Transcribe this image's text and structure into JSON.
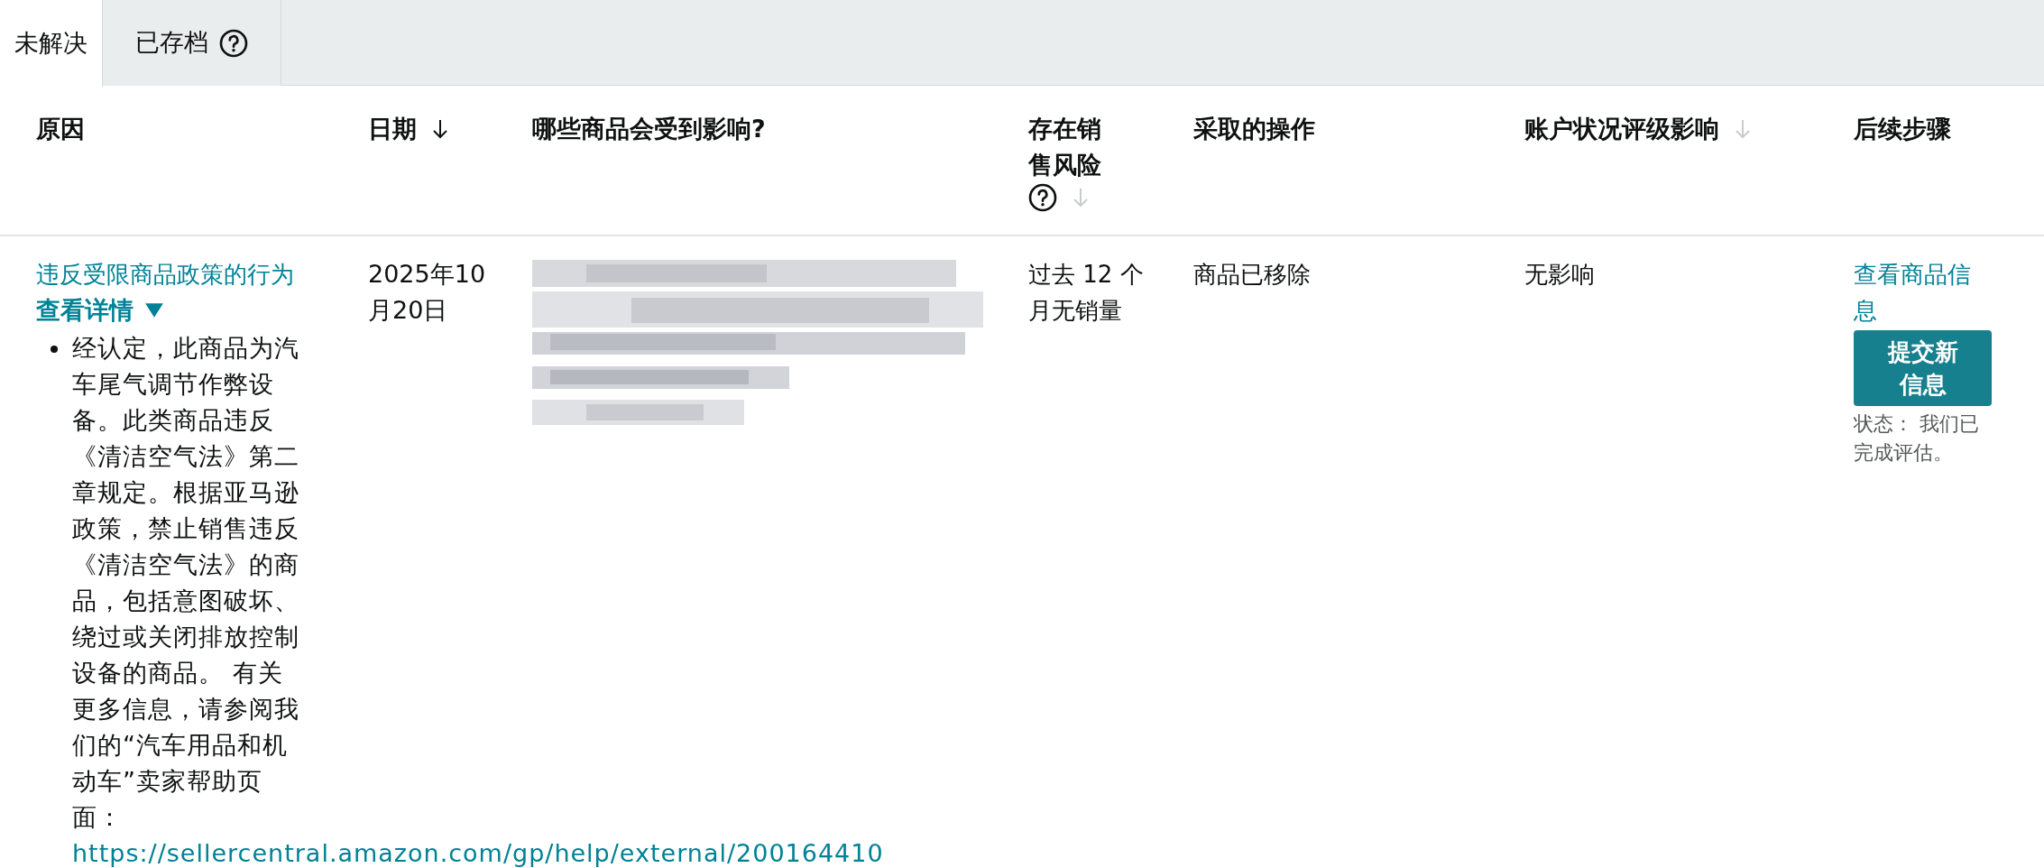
{
  "tabs": [
    {
      "label": "未解决",
      "selected": true
    },
    {
      "label": "已存档",
      "selected": false,
      "help": true
    }
  ],
  "table": {
    "columns": [
      {
        "label": "原因"
      },
      {
        "label": "日期",
        "sort_active": true
      },
      {
        "label": "哪些商品会受到影响?"
      },
      {
        "label": "存在销售风险",
        "sort_active": false,
        "help": true
      },
      {
        "label": "采取的操作"
      },
      {
        "label": "账户状况评级影响",
        "sort_active": false
      },
      {
        "label": "后续步骤"
      }
    ],
    "rows": [
      {
        "reason": {
          "title": "违反受限商品政策的行为",
          "toggle": "查看详情",
          "expanded": true,
          "details": "经认定，此商品为汽车尾气调节作弊设备。此类商品违反《清洁空气法》第二章规定。根据亚马逊政策，禁止销售违反《清洁空气法》的商品，包括意图破坏、绕过或关闭排放控制设备的商品。 有关更多信息，请参阅我们的“汽车用品和机动车”卖家帮助页面：",
          "link": "https://sellercentral.amazon.com/gp/help/external/200164410"
        },
        "date": "2025年10月20日",
        "sales_risk": "过去 12 个月无销量",
        "action": "商品已移除",
        "impact": "无影响",
        "next_steps": {
          "link": "查看商品信息",
          "button": "提交新信息",
          "status": "状态： 我们已完成评估。"
        }
      }
    ]
  }
}
